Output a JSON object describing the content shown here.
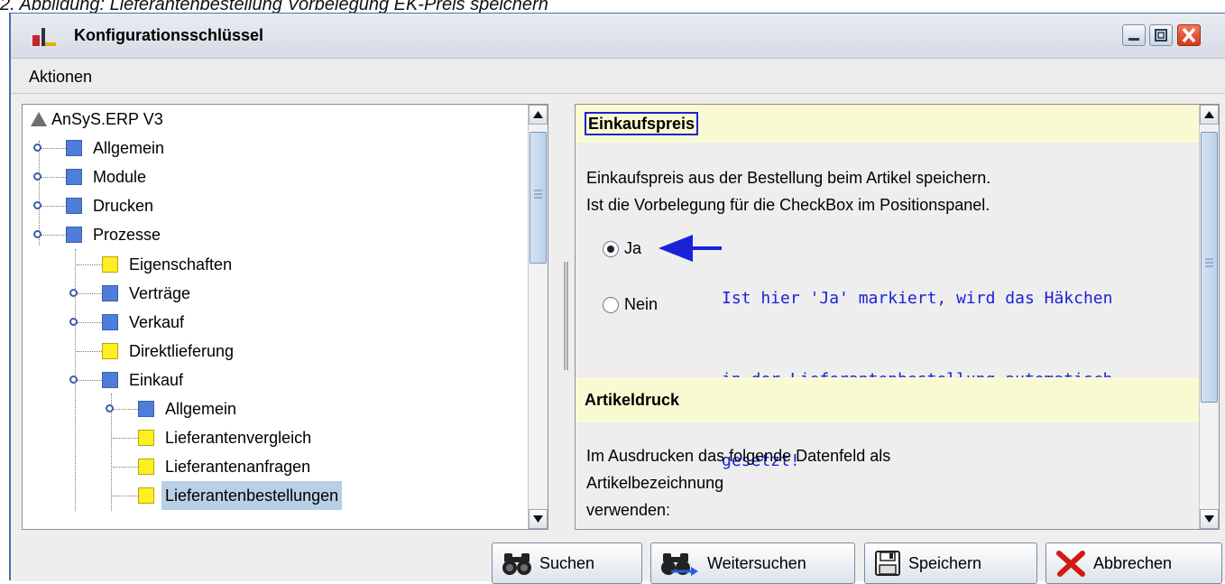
{
  "caption": "2. Abbildung: Lieferantenbestellung Vorbelegung EK-Preis speichern",
  "window": {
    "title": "Konfigurationsschlüssel",
    "controls": [
      "minimize-icon",
      "maximize-icon",
      "close-icon"
    ]
  },
  "menu": {
    "items": [
      "Aktionen"
    ]
  },
  "tree": {
    "root": "AnSyS.ERP V3",
    "nodes": [
      {
        "label": "Allgemein",
        "color": "blue"
      },
      {
        "label": "Module",
        "color": "blue"
      },
      {
        "label": "Drucken",
        "color": "blue"
      },
      {
        "label": "Prozesse",
        "color": "blue"
      },
      {
        "label": "Eigenschaften",
        "color": "yellow"
      },
      {
        "label": "Verträge",
        "color": "blue"
      },
      {
        "label": "Verkauf",
        "color": "blue"
      },
      {
        "label": "Direktlieferung",
        "color": "yellow"
      },
      {
        "label": "Einkauf",
        "color": "blue"
      },
      {
        "label": "Allgemein",
        "color": "blue"
      },
      {
        "label": "Lieferantenvergleich",
        "color": "yellow"
      },
      {
        "label": "Lieferantenanfragen",
        "color": "yellow"
      },
      {
        "label": "Lieferantenbestellungen",
        "color": "yellow",
        "selected": true
      }
    ]
  },
  "detail": {
    "section1_title": "Einkaufspreis",
    "section1_line1": "Einkaufspreis aus der Bestellung beim Artikel speichern.",
    "section1_line2": "Ist die Vorbelegung für die CheckBox im Positionspanel.",
    "option_ja": "Ja",
    "option_nein": "Nein",
    "selected_option": "Ja",
    "annotation_line1": "Ist hier 'Ja' markiert, wird das Häkchen",
    "annotation_line2": "in der Lieferantenbestellung automatisch",
    "annotation_line3": "gesetzt!",
    "section2_title": "Artikeldruck",
    "section2_line1": "Im Ausdrucken das folgende Datenfeld als",
    "section2_line2": "Artikelbezeichnung",
    "section2_line3": "verwenden:"
  },
  "buttons": {
    "suchen": "Suchen",
    "weitersuchen": "Weitersuchen",
    "speichern": "Speichern",
    "abbrechen": "Abbrechen"
  },
  "colors": {
    "accent_blue": "#1a22d8",
    "section_header_bg": "#fafad2",
    "selection_bg": "#b8cfe5",
    "folder_blue": "#4f7ddb",
    "leaf_yellow": "#ffee22"
  }
}
